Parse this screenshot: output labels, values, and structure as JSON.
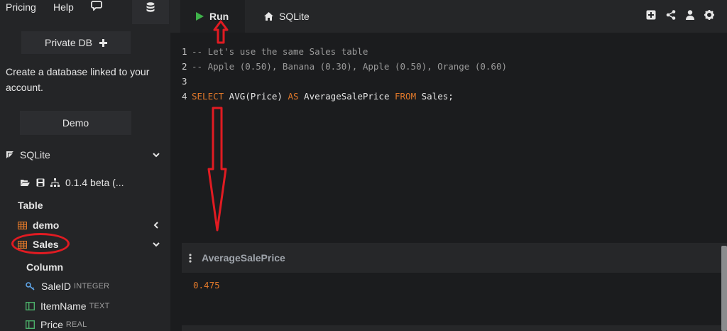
{
  "topnav": {
    "pricing": "Pricing",
    "help": "Help",
    "chat_icon": "chat-icon",
    "db_icon": "database-icon"
  },
  "sidebar": {
    "private_db": "Private DB",
    "message": "Create a database linked to your account.",
    "demo": "Demo",
    "sqlite_label": "SQLite",
    "version": "0.1.4 beta (...",
    "table_heading": "Table",
    "tables": [
      {
        "label": "demo",
        "chevron": "chevron-left-icon"
      },
      {
        "label": "Sales",
        "chevron": "chevron-down-icon"
      }
    ],
    "column_heading": "Column",
    "columns": [
      {
        "name": "SaleID",
        "type": "INTEGER",
        "icon": "key-icon"
      },
      {
        "name": "ItemName",
        "type": "TEXT",
        "icon": "column-icon"
      },
      {
        "name": "Price",
        "type": "REAL",
        "icon": "column-icon"
      }
    ]
  },
  "tabs": {
    "run": "Run",
    "sqlite": "SQLite"
  },
  "editor": {
    "lines": [
      {
        "num": "1",
        "text": "-- Let's use the same Sales table"
      },
      {
        "num": "2",
        "text": "-- Apple (0.50), Banana (0.30), Apple (0.50), Orange (0.60)"
      },
      {
        "num": "3",
        "text": ""
      },
      {
        "num": "4",
        "kw1": "SELECT",
        "t1": " AVG(Price) ",
        "kw2": "AS",
        "t2": " AverageSalePrice ",
        "kw3": "FROM",
        "t3": " Sales;"
      }
    ]
  },
  "result": {
    "column": "AverageSalePrice",
    "value": "0.475"
  },
  "colors": {
    "accent": "#e0782a",
    "annotation": "#e11b22",
    "run_green": "#3fb24a"
  }
}
